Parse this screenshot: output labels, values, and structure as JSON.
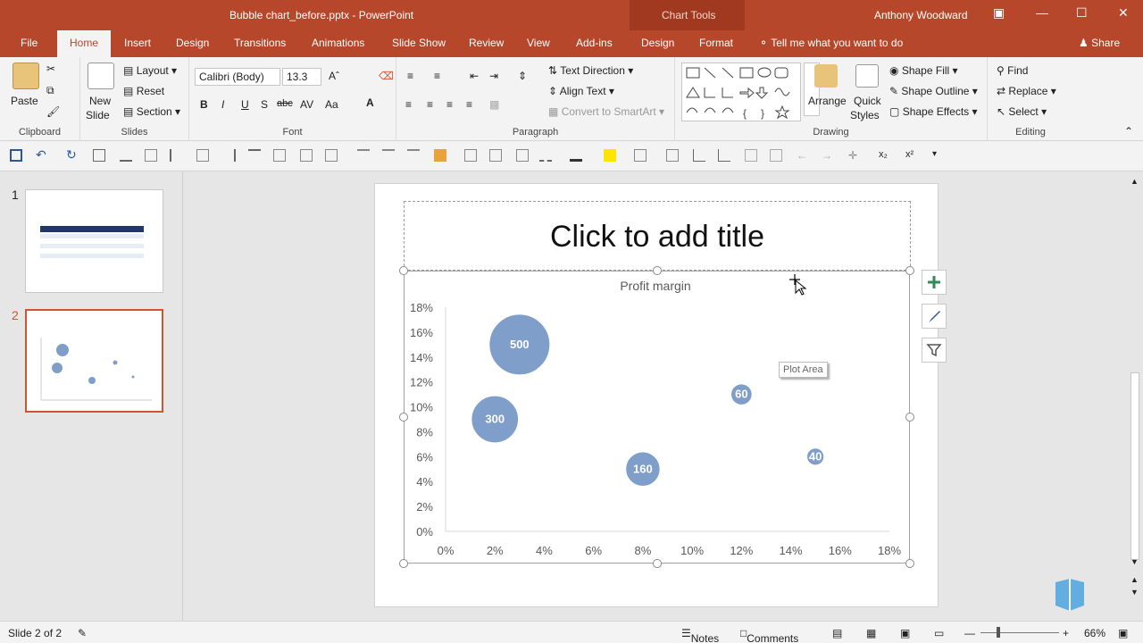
{
  "window": {
    "title": "Bubble chart_before.pptx - PowerPoint",
    "context_group": "Chart Tools",
    "user": "Anthony Woodward"
  },
  "tabs": [
    "File",
    "Home",
    "Insert",
    "Design",
    "Transitions",
    "Animations",
    "Slide Show",
    "Review",
    "View",
    "Add-ins",
    "Design",
    "Format"
  ],
  "tell_me": "Tell me what you want to do",
  "share": "Share",
  "ribbon": {
    "clipboard": {
      "label": "Clipboard",
      "paste": "Paste"
    },
    "slides": {
      "label": "Slides",
      "new_slide_1": "New",
      "new_slide_2": "Slide",
      "layout": "Layout",
      "reset": "Reset",
      "section": "Section"
    },
    "font": {
      "label": "Font",
      "font_name": "Calibri (Body)",
      "font_size": "13.3"
    },
    "paragraph": {
      "label": "Paragraph",
      "text_direction": "Text Direction",
      "align_text": "Align Text",
      "convert_smartart": "Convert to SmartArt"
    },
    "drawing": {
      "label": "Drawing",
      "arrange": "Arrange",
      "quick_styles_1": "Quick",
      "quick_styles_2": "Styles",
      "shape_fill": "Shape Fill",
      "shape_outline": "Shape Outline",
      "shape_effects": "Shape Effects"
    },
    "editing": {
      "label": "Editing",
      "find": "Find",
      "replace": "Replace",
      "select": "Select"
    }
  },
  "thumbnails": [
    "1",
    "2"
  ],
  "slide": {
    "title_placeholder": "Click to add title",
    "tooltip": "Plot Area"
  },
  "chart_data": {
    "type": "scatter",
    "title": "Profit margin",
    "xlabel": "",
    "ylabel": "",
    "xlim": [
      0,
      18
    ],
    "ylim": [
      0,
      18
    ],
    "x_ticks": [
      "0%",
      "2%",
      "4%",
      "6%",
      "8%",
      "10%",
      "12%",
      "14%",
      "16%",
      "18%"
    ],
    "y_ticks": [
      "0%",
      "2%",
      "4%",
      "6%",
      "8%",
      "10%",
      "12%",
      "14%",
      "16%",
      "18%"
    ],
    "points": [
      {
        "x": 3,
        "y": 15,
        "size": 500,
        "label": "500"
      },
      {
        "x": 2,
        "y": 9,
        "size": 300,
        "label": "300"
      },
      {
        "x": 8,
        "y": 5,
        "size": 160,
        "label": "160"
      },
      {
        "x": 12,
        "y": 11,
        "size": 60,
        "label": "60"
      },
      {
        "x": 15,
        "y": 6,
        "size": 40,
        "label": "40"
      }
    ],
    "bubble_color": "#7f9ec9",
    "grid": false
  },
  "status": {
    "slide_info": "Slide 2 of 2",
    "notes": "Notes",
    "comments": "Comments",
    "zoom": "66%"
  }
}
